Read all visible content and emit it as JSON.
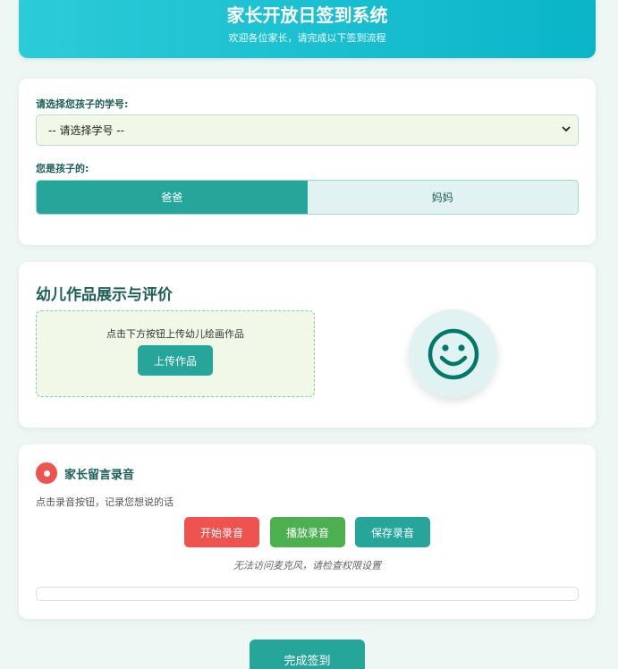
{
  "header": {
    "title": "家长开放日签到系统",
    "subtitle": "欢迎各位家长，请完成以下签到流程"
  },
  "signin": {
    "student_label": "请选择您孩子的学号:",
    "student_select_value": "-- 请选择学号 --",
    "relation_label": "您是孩子的:",
    "relation_options": [
      "爸爸",
      "妈妈"
    ],
    "relation_selected": "爸爸"
  },
  "artwork": {
    "title": "幼儿作品展示与评价",
    "upload_hint": "点击下方按钮上传幼儿绘画作品",
    "upload_button": "上传作品",
    "face_icon": "smiley-face-icon"
  },
  "recording": {
    "icon": "record-icon",
    "title": "家长留言录音",
    "hint": "点击录音按钮，记录您想说的话",
    "start_button": "开始录音",
    "play_button": "播放录音",
    "save_button": "保存录音",
    "mic_error": "无法访问麦克风，请检查权限设置",
    "progress_percent": 0
  },
  "submit_button": "完成签到",
  "colors": {
    "primary": "#26a69a",
    "header_gradient_start": "#2ccbd8",
    "header_gradient_end": "#0ab5c8",
    "record_red": "#ef5350",
    "play_green": "#4caf50",
    "title_text": "#1b5e56",
    "page_bg": "#eef7f3"
  }
}
